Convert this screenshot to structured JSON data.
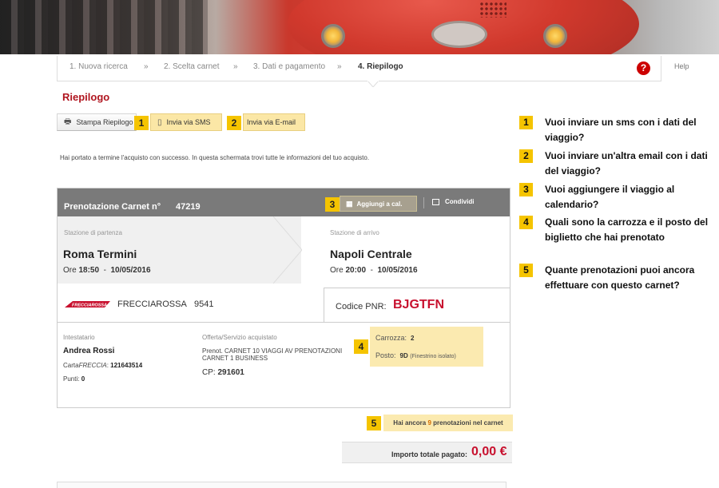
{
  "steps": [
    {
      "label": "1. Nuova ricerca"
    },
    {
      "label": "2. Scelta carnet"
    },
    {
      "label": "3. Dati e pagamento"
    },
    {
      "label": "4. Riepilogo"
    }
  ],
  "step_separator": "»",
  "help": {
    "label": "Help",
    "icon_text": "?"
  },
  "page_title": "Riepilogo",
  "buttons": {
    "print": "Stampa Riepilogo",
    "sms": "Invia via SMS",
    "email": "Invia via E-mail",
    "calendar": "Aggiungi a cal.",
    "share": "Condividi"
  },
  "callouts": [
    "1",
    "2",
    "3",
    "4",
    "5"
  ],
  "intro": "Hai portato a termine l'acquisto con successo. In questa schermata trovi tutte le informazioni del tuo acquisto.",
  "booking": {
    "title": "Prenotazione Carnet n°",
    "number": "47219",
    "departure": {
      "label": "Stazione di partenza",
      "station": "Roma Termini",
      "time_prefix": "Ore",
      "time": "18:50",
      "dash": "-",
      "date": "10/05/2016"
    },
    "arrival": {
      "label": "Stazione di arrivo",
      "station": "Napoli Centrale",
      "time_prefix": "Ore",
      "time": "20:00",
      "dash": "-",
      "date": "10/05/2016"
    },
    "train": {
      "logo_text": "FRECCIAROSSA",
      "name": "FRECCIAROSSA",
      "number": "9541"
    },
    "pnr": {
      "label": "Codice PNR:",
      "value": "BJGTFN"
    },
    "holder": {
      "label": "Intestatario",
      "name": "Andrea Rossi",
      "card_label_1": "Carta",
      "card_label_2": "FRECCIA",
      "card_label_3": ":",
      "card_number": "121643514",
      "points_label": "Punti:",
      "points": "0"
    },
    "offer": {
      "label": "Offerta/Servizio acquistato",
      "line1": "Prenot. CARNET 10 VIAGGI AV PRENOTAZIONI",
      "line2": "CARNET 1 BUSINESS",
      "cp_label": "CP:",
      "cp_value": "291601"
    },
    "seat": {
      "coach_label": "Carrozza:",
      "coach": "2",
      "seat_label": "Posto:",
      "seat": "9D",
      "seat_note": "(Finestrino isolato)"
    }
  },
  "remaining": {
    "prefix": "Hai ancora",
    "count": "9",
    "suffix": "prenotazioni nel carnet"
  },
  "total": {
    "label": "Importo totale pagato:",
    "value": "0,00 €"
  },
  "notes": [
    {
      "num": "1",
      "text": "Vuoi inviare un sms con i dati del viaggio?"
    },
    {
      "num": "2",
      "text": "Vuoi inviare un'altra email con i dati del viaggio?"
    },
    {
      "num": "3",
      "text": "Vuoi aggiungere il viaggio al calendario?"
    },
    {
      "num": "4",
      "text": "Quali sono la carrozza e il posto del biglietto che hai prenotato"
    },
    {
      "num": "5",
      "text": "Quante prenotazioni puoi ancora effettuare con questo carnet?"
    }
  ],
  "colors": {
    "brand_red": "#b0151f",
    "pnr_red": "#c8102e",
    "highlight": "#f5c400",
    "highlight_bg": "#fbeab0"
  }
}
